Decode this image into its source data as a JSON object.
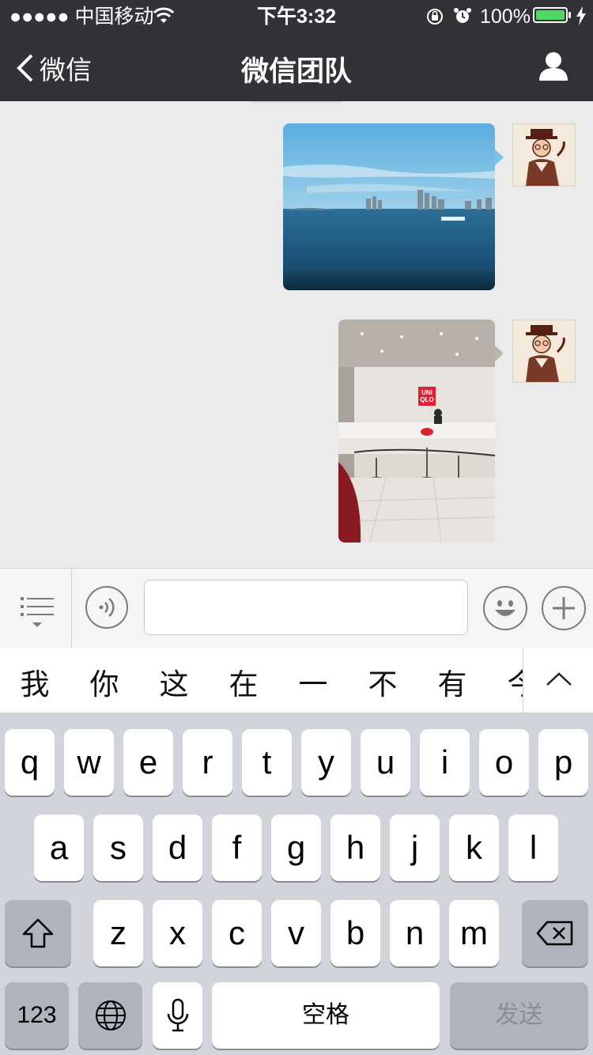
{
  "status_bar": {
    "carrier": "●●●●● 中国移动",
    "time": "下午3:32",
    "battery_percent": "100%",
    "battery_level": 1.0
  },
  "nav": {
    "back_label": "微信",
    "title": "微信团队",
    "back_icon": "chevron-left-icon",
    "profile_icon": "person-icon"
  },
  "chat": {
    "messages": [
      {
        "type": "image",
        "sender": "self",
        "content": "sea-with-city-skyline-photo"
      },
      {
        "type": "image",
        "sender": "self",
        "content": "uniqlo-store-counter-photo"
      }
    ],
    "store_sign": "UNI QLO"
  },
  "input_bar": {
    "menu_icon": "list-menu-icon",
    "voice_icon": "voice-icon",
    "emoji_icon": "emoji-icon",
    "plus_icon": "plus-icon",
    "text_value": ""
  },
  "candidates": {
    "items": [
      "我",
      "你",
      "这",
      "在",
      "一",
      "不",
      "有",
      "今"
    ],
    "expand_icon": "chevron-up-icon"
  },
  "keyboard": {
    "row1": [
      "q",
      "w",
      "e",
      "r",
      "t",
      "y",
      "u",
      "i",
      "o",
      "p"
    ],
    "row2": [
      "a",
      "s",
      "d",
      "f",
      "g",
      "h",
      "j",
      "k",
      "l"
    ],
    "row3": [
      "z",
      "x",
      "c",
      "v",
      "b",
      "n",
      "m"
    ],
    "numbers_label": "123",
    "space_label": "空格",
    "send_label": "发送",
    "shift_icon": "shift-icon",
    "delete_icon": "delete-icon",
    "globe_icon": "globe-icon",
    "mic_icon": "microphone-icon"
  },
  "colors": {
    "nav_bg": "#323336",
    "chat_bg": "#ebebeb",
    "battery_green": "#4cd964",
    "keyboard_bg": "#d1d4db"
  }
}
